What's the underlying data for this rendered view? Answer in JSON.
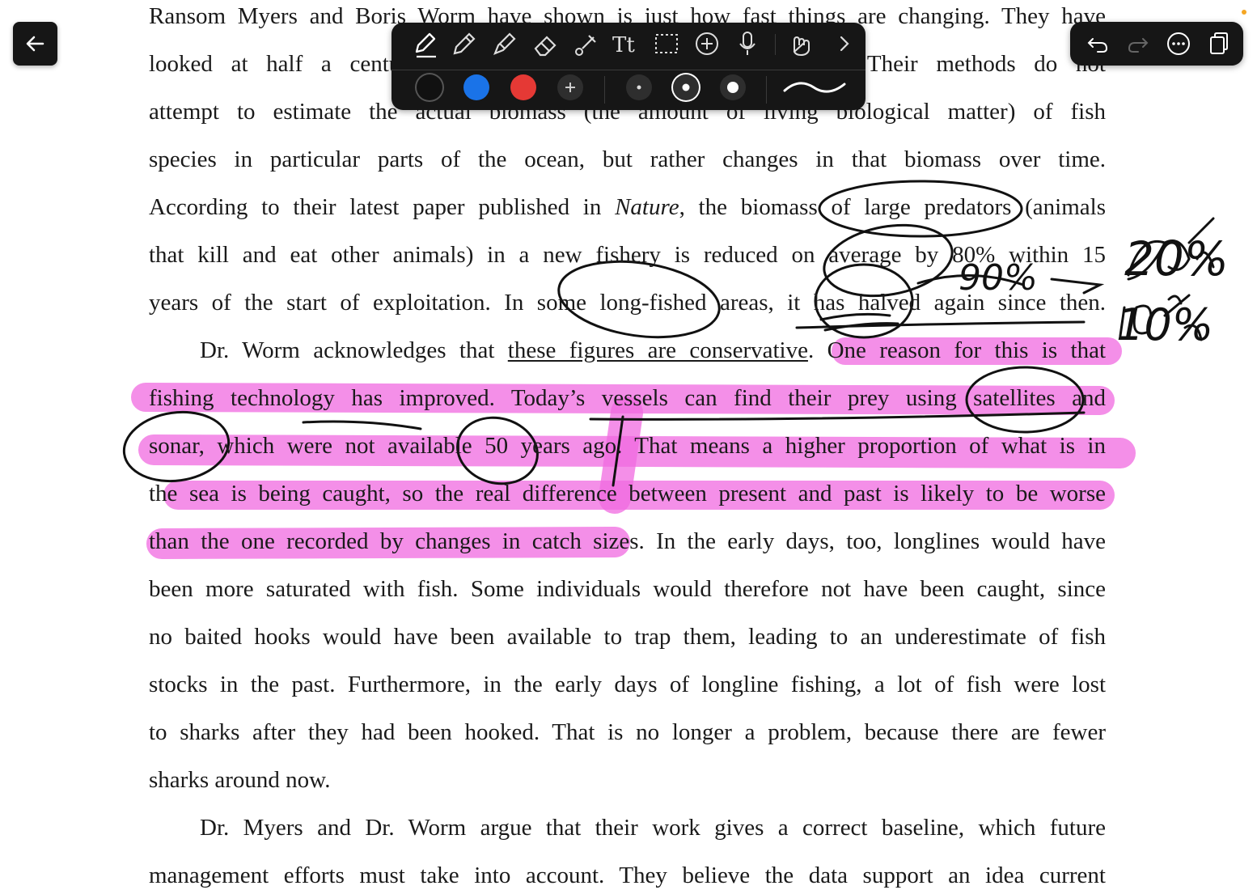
{
  "document": {
    "lines": [
      "Ransom Myers and Boris Worm have shown is just how fast things are changing. They have",
      "looked at half a century of data on the world's fishing fleets. Their methods do not",
      "attempt to estimate the actual biomass (the amount of living biological matter) of fish",
      "species in particular parts of the ocean, but rather changes in that biomass over time.",
      "According to their latest paper published in ",
      "Nature",
      ", the biomass of large predators (animals",
      "that kill and eat other animals) in a new fishery is reduced on average by 80% within 15",
      "years of the start of exploitation. In some long-fished areas, it has halved again since then.",
      "Dr. Worm acknowledges that ",
      "these figures are conservative",
      ". One reason for this is that",
      "fishing technology has improved. Today’s vessels can find their prey using satellites and",
      "sonar, which were not available 50 years ago. That means a higher proportion of what is in",
      "the sea is being caught, so the real difference between present and past is likely to be worse",
      "than the one recorded by changes in catch sizes. In the early days, too, longlines would have",
      "been more saturated with fish. Some individuals would therefore not have been caught, since",
      "no baited hooks would have been available to trap them, leading to an underestimate of fish",
      "stocks in the past. Furthermore, in the early days of longline fishing, a lot of fish were lost",
      "to sharks after they had been hooked. That is no longer a problem, because there are fewer",
      "sharks around now.",
      "Dr. Myers and Dr. Worm argue that their work gives a correct baseline, which future",
      "management efforts must take into account. They believe the data support an idea current"
    ]
  },
  "handwriting": {
    "note_90": "90%",
    "note_20": "20%",
    "note_10": "10%"
  },
  "toolbar": {
    "tools": [
      "pen-tool",
      "pencil-tool",
      "highlighter-tool",
      "eraser-tool",
      "shape-tool",
      "text-tool",
      "lasso-select-tool",
      "add-element-tool",
      "microphone-tool",
      "touch-draw-tool",
      "more-tools-chevron"
    ],
    "text_tool_label": "Tt",
    "colors": [
      "#111111",
      "#1a73e8",
      "#e53935"
    ],
    "active_color": "#111111"
  },
  "colors": {
    "highlight": "#f06ae0",
    "ink": "#111111",
    "bar": "#161616"
  }
}
